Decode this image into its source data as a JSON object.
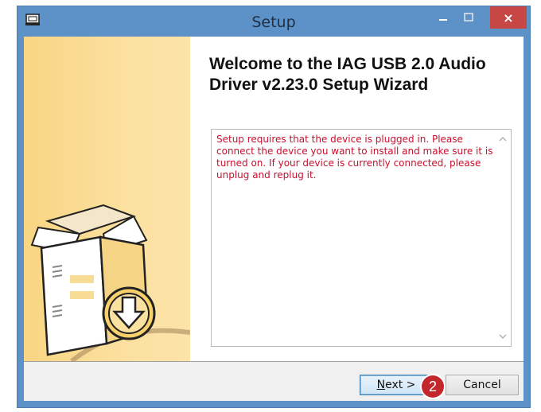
{
  "window": {
    "title": "Setup",
    "close_glyph": "×"
  },
  "wizard": {
    "heading": "Welcome to the IAG USB 2.0 Audio Driver v2.23.0 Setup Wizard",
    "message": "Setup requires that the device is plugged in. Please connect the device you want to install and make sure it is turned on. If your device is currently connected, please unplug and replug it."
  },
  "buttons": {
    "next_label_accel": "N",
    "next_label_rest": "ext >",
    "cancel_label": "Cancel"
  },
  "annotation": {
    "callout_number": "2"
  },
  "icons": {
    "app": "installer-icon",
    "minimize": "minimize-icon",
    "maximize": "maximize-icon",
    "close": "close-icon",
    "illustration": "package-download-icon",
    "scroll_up": "scroll-up-icon",
    "scroll_down": "scroll-down-icon"
  },
  "colors": {
    "titlebar": "#5d92c9",
    "close_button": "#c64743",
    "message_text": "#c8102e",
    "sidebar": "#f8d582",
    "callout": "#c1272d"
  }
}
